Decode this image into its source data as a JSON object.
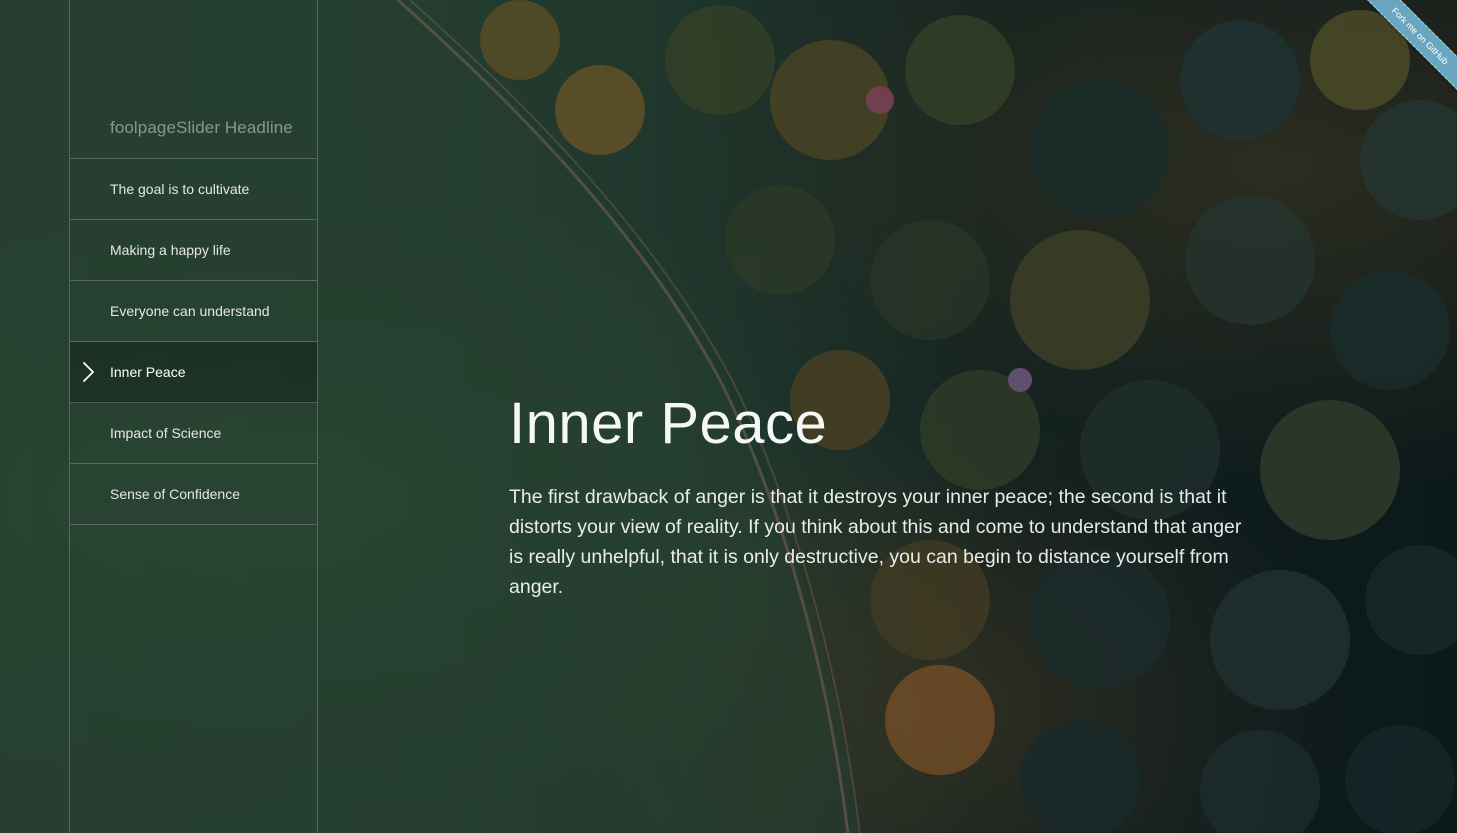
{
  "sidebar": {
    "headline": "foolpageSlider Headline",
    "items": [
      {
        "label": "The goal is to cultivate",
        "active": false
      },
      {
        "label": "Making a happy life",
        "active": false
      },
      {
        "label": "Everyone can understand",
        "active": false
      },
      {
        "label": "Inner Peace",
        "active": true
      },
      {
        "label": "Impact of Science",
        "active": false
      },
      {
        "label": "Sense of Confidence",
        "active": false
      }
    ],
    "active_icon": "chevron-right-icon"
  },
  "main": {
    "title": "Inner Peace",
    "body": "The first drawback of anger is that it destroys your inner peace; the second is that it distorts your view of reality. If you think about this and come to understand that anger is really unhelpful, that it is only destructive, you can begin to distance yourself from anger."
  },
  "ribbon": {
    "label": "Fork me on GitHub",
    "color": "#6aa6c2"
  }
}
